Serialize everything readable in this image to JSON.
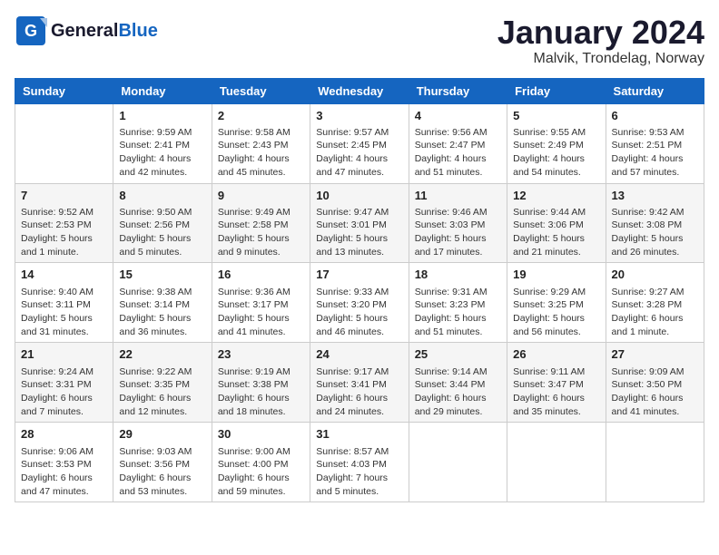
{
  "header": {
    "logo_general": "General",
    "logo_blue": "Blue",
    "title": "January 2024",
    "subtitle": "Malvik, Trondelag, Norway"
  },
  "columns": [
    "Sunday",
    "Monday",
    "Tuesday",
    "Wednesday",
    "Thursday",
    "Friday",
    "Saturday"
  ],
  "weeks": [
    [
      {
        "day": "",
        "info": ""
      },
      {
        "day": "1",
        "info": "Sunrise: 9:59 AM\nSunset: 2:41 PM\nDaylight: 4 hours\nand 42 minutes."
      },
      {
        "day": "2",
        "info": "Sunrise: 9:58 AM\nSunset: 2:43 PM\nDaylight: 4 hours\nand 45 minutes."
      },
      {
        "day": "3",
        "info": "Sunrise: 9:57 AM\nSunset: 2:45 PM\nDaylight: 4 hours\nand 47 minutes."
      },
      {
        "day": "4",
        "info": "Sunrise: 9:56 AM\nSunset: 2:47 PM\nDaylight: 4 hours\nand 51 minutes."
      },
      {
        "day": "5",
        "info": "Sunrise: 9:55 AM\nSunset: 2:49 PM\nDaylight: 4 hours\nand 54 minutes."
      },
      {
        "day": "6",
        "info": "Sunrise: 9:53 AM\nSunset: 2:51 PM\nDaylight: 4 hours\nand 57 minutes."
      }
    ],
    [
      {
        "day": "7",
        "info": "Sunrise: 9:52 AM\nSunset: 2:53 PM\nDaylight: 5 hours\nand 1 minute."
      },
      {
        "day": "8",
        "info": "Sunrise: 9:50 AM\nSunset: 2:56 PM\nDaylight: 5 hours\nand 5 minutes."
      },
      {
        "day": "9",
        "info": "Sunrise: 9:49 AM\nSunset: 2:58 PM\nDaylight: 5 hours\nand 9 minutes."
      },
      {
        "day": "10",
        "info": "Sunrise: 9:47 AM\nSunset: 3:01 PM\nDaylight: 5 hours\nand 13 minutes."
      },
      {
        "day": "11",
        "info": "Sunrise: 9:46 AM\nSunset: 3:03 PM\nDaylight: 5 hours\nand 17 minutes."
      },
      {
        "day": "12",
        "info": "Sunrise: 9:44 AM\nSunset: 3:06 PM\nDaylight: 5 hours\nand 21 minutes."
      },
      {
        "day": "13",
        "info": "Sunrise: 9:42 AM\nSunset: 3:08 PM\nDaylight: 5 hours\nand 26 minutes."
      }
    ],
    [
      {
        "day": "14",
        "info": "Sunrise: 9:40 AM\nSunset: 3:11 PM\nDaylight: 5 hours\nand 31 minutes."
      },
      {
        "day": "15",
        "info": "Sunrise: 9:38 AM\nSunset: 3:14 PM\nDaylight: 5 hours\nand 36 minutes."
      },
      {
        "day": "16",
        "info": "Sunrise: 9:36 AM\nSunset: 3:17 PM\nDaylight: 5 hours\nand 41 minutes."
      },
      {
        "day": "17",
        "info": "Sunrise: 9:33 AM\nSunset: 3:20 PM\nDaylight: 5 hours\nand 46 minutes."
      },
      {
        "day": "18",
        "info": "Sunrise: 9:31 AM\nSunset: 3:23 PM\nDaylight: 5 hours\nand 51 minutes."
      },
      {
        "day": "19",
        "info": "Sunrise: 9:29 AM\nSunset: 3:25 PM\nDaylight: 5 hours\nand 56 minutes."
      },
      {
        "day": "20",
        "info": "Sunrise: 9:27 AM\nSunset: 3:28 PM\nDaylight: 6 hours\nand 1 minute."
      }
    ],
    [
      {
        "day": "21",
        "info": "Sunrise: 9:24 AM\nSunset: 3:31 PM\nDaylight: 6 hours\nand 7 minutes."
      },
      {
        "day": "22",
        "info": "Sunrise: 9:22 AM\nSunset: 3:35 PM\nDaylight: 6 hours\nand 12 minutes."
      },
      {
        "day": "23",
        "info": "Sunrise: 9:19 AM\nSunset: 3:38 PM\nDaylight: 6 hours\nand 18 minutes."
      },
      {
        "day": "24",
        "info": "Sunrise: 9:17 AM\nSunset: 3:41 PM\nDaylight: 6 hours\nand 24 minutes."
      },
      {
        "day": "25",
        "info": "Sunrise: 9:14 AM\nSunset: 3:44 PM\nDaylight: 6 hours\nand 29 minutes."
      },
      {
        "day": "26",
        "info": "Sunrise: 9:11 AM\nSunset: 3:47 PM\nDaylight: 6 hours\nand 35 minutes."
      },
      {
        "day": "27",
        "info": "Sunrise: 9:09 AM\nSunset: 3:50 PM\nDaylight: 6 hours\nand 41 minutes."
      }
    ],
    [
      {
        "day": "28",
        "info": "Sunrise: 9:06 AM\nSunset: 3:53 PM\nDaylight: 6 hours\nand 47 minutes."
      },
      {
        "day": "29",
        "info": "Sunrise: 9:03 AM\nSunset: 3:56 PM\nDaylight: 6 hours\nand 53 minutes."
      },
      {
        "day": "30",
        "info": "Sunrise: 9:00 AM\nSunset: 4:00 PM\nDaylight: 6 hours\nand 59 minutes."
      },
      {
        "day": "31",
        "info": "Sunrise: 8:57 AM\nSunset: 4:03 PM\nDaylight: 7 hours\nand 5 minutes."
      },
      {
        "day": "",
        "info": ""
      },
      {
        "day": "",
        "info": ""
      },
      {
        "day": "",
        "info": ""
      }
    ]
  ]
}
